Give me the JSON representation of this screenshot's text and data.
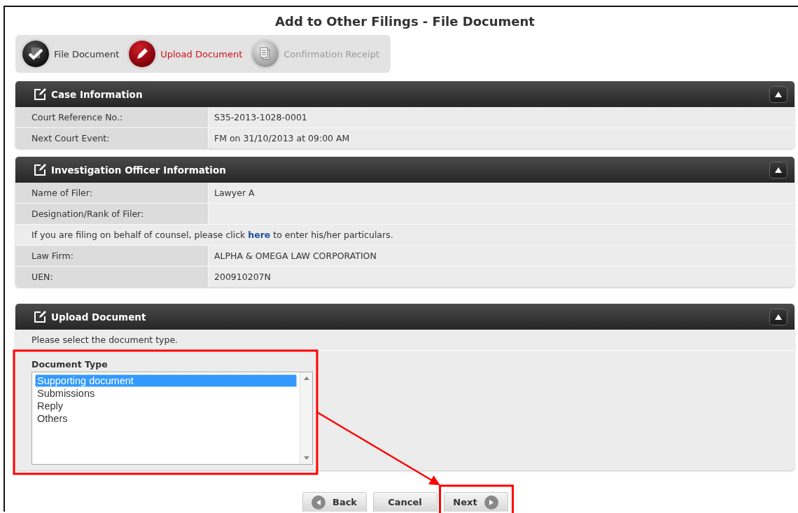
{
  "title": "Add to Other Filings - File Document",
  "steps": [
    {
      "label": "File Document",
      "selected": false
    },
    {
      "label": "Upload Document",
      "selected": true
    },
    {
      "label": "Confirmation Receipt",
      "selected": false
    }
  ],
  "panels": [
    {
      "title": "Case Information",
      "expanded": true,
      "rows": [
        {
          "kind": "field",
          "label": "Court Reference No.:",
          "value": "S35-2013-1028-0001"
        },
        {
          "kind": "field",
          "label": "Next Court Event:",
          "value": "FM on 31/10/2013 at 09:00 AM"
        }
      ]
    },
    {
      "title": "Investigation Officer Information",
      "expanded": true,
      "rows": [
        {
          "kind": "field",
          "label": "Name of Filer:",
          "value": "Lawyer A"
        },
        {
          "kind": "field",
          "label": "Designation/Rank of Filer:"
        },
        {
          "kind": "note",
          "text": "If you are filing on behalf of counsel, please click ",
          "link": "here",
          "after": " to enter his/her particulars."
        },
        {
          "kind": "field",
          "label": "Law Firm:",
          "value": "ALPHA & OMEGA LAW CORPORATION"
        },
        {
          "kind": "field",
          "label": "UEN:",
          "value": "200910207N"
        }
      ]
    },
    {
      "title": "Upload Document",
      "expanded": true,
      "rows": [
        {
          "kind": "note",
          "text": "Please select the document type."
        },
        {
          "kind": "listbox",
          "label": "Document Type",
          "options": [
            {
              "label": "Supporting document",
              "selected": true
            },
            {
              "label": "Submissions",
              "selected": false
            },
            {
              "label": "Reply",
              "selected": false
            },
            {
              "label": "Others",
              "selected": false
            }
          ]
        }
      ]
    }
  ],
  "buttons": [
    {
      "label": "Back"
    },
    {
      "label": "Cancel"
    },
    {
      "label": "Next"
    }
  ],
  "annotations": [
    {
      "kind": "box"
    },
    {
      "kind": "arrow"
    },
    {
      "kind": "box"
    }
  ]
}
